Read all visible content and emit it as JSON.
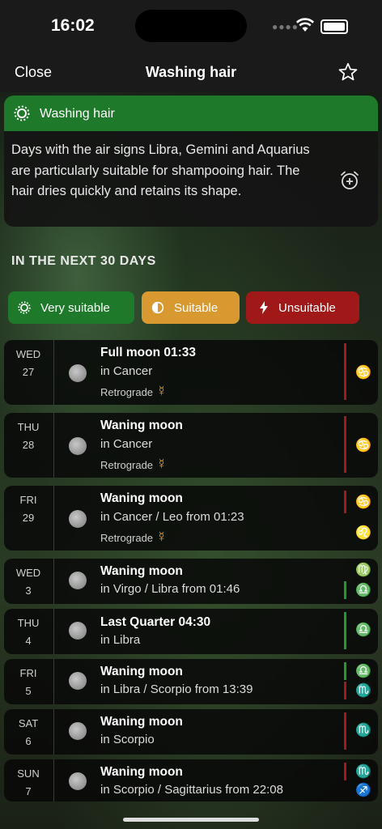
{
  "status": {
    "time": "16:02"
  },
  "nav": {
    "close": "Close",
    "title": "Washing hair"
  },
  "info_card": {
    "title": "Washing hair",
    "text": "Days with the air signs Libra, Gemini and Aquarius are particularly suitable for shampooing hair. The hair dries quickly and retains its shape."
  },
  "section_title": "IN THE NEXT 30 DAYS",
  "legend": {
    "very_suitable": "Very suitable",
    "suitable": "Suitable",
    "unsuitable": "Unsuitable"
  },
  "colors": {
    "very_suitable": "#1e7a2a",
    "suitable": "#d89a30",
    "unsuitable": "#a01818",
    "accent_blue": "#5aa8ff"
  },
  "days": [
    {
      "dow": "WED",
      "date": "27",
      "phase": "Full moon 01:33",
      "sign": "in Cancer",
      "retro": "Retrograde",
      "symbols": [
        "♋"
      ],
      "ratings": [
        "unsuitable"
      ]
    },
    {
      "dow": "THU",
      "date": "28",
      "phase": "Waning moon",
      "sign": "in Cancer",
      "retro": "Retrograde",
      "symbols": [
        "♋"
      ],
      "ratings": [
        "unsuitable"
      ]
    },
    {
      "dow": "FRI",
      "date": "29",
      "phase": "Waning moon",
      "sign": "in Cancer / Leo from 01:23",
      "retro": "Retrograde",
      "symbols": [
        "♋",
        "♌"
      ],
      "ratings": [
        "unsuitable"
      ]
    },
    {
      "dow": "WED",
      "date": "3",
      "phase": "Waning moon",
      "sign": "in Virgo / Libra from 01:46",
      "symbols": [
        "♍",
        "♎"
      ],
      "ratings": [
        "very_suitable"
      ]
    },
    {
      "dow": "THU",
      "date": "4",
      "phase": "Last Quarter 04:30",
      "sign": "in Libra",
      "symbols": [
        "♎"
      ],
      "ratings": [
        "very_suitable"
      ]
    },
    {
      "dow": "FRI",
      "date": "5",
      "phase": "Waning moon",
      "sign": "in Libra / Scorpio from 13:39",
      "symbols": [
        "♎",
        "♏"
      ],
      "ratings": [
        "very_suitable",
        "unsuitable"
      ]
    },
    {
      "dow": "SAT",
      "date": "6",
      "phase": "Waning moon",
      "sign": "in Scorpio",
      "symbols": [
        "♏"
      ],
      "ratings": [
        "unsuitable"
      ]
    },
    {
      "dow": "SUN",
      "date": "7",
      "phase": "Waning moon",
      "sign": "in Scorpio / Sagittarius from 22:08",
      "symbols": [
        "♏",
        "♐"
      ],
      "ratings": [
        "unsuitable"
      ]
    }
  ]
}
